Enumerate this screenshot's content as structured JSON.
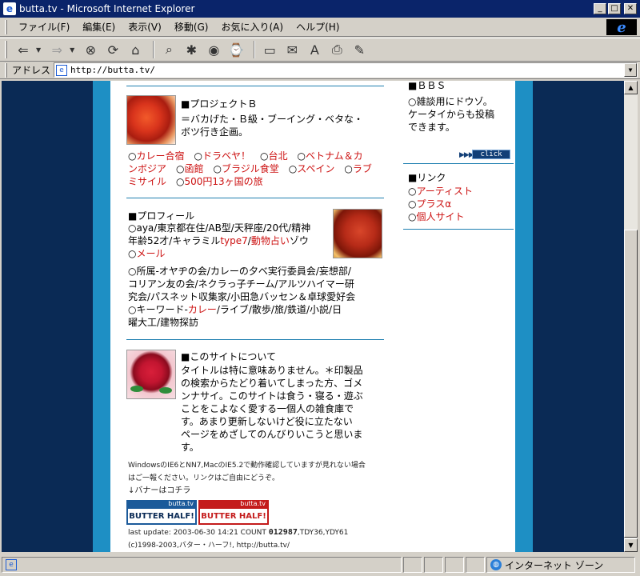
{
  "window": {
    "title": "butta.tv - Microsoft Internet Explorer"
  },
  "menu": [
    "ファイル(F)",
    "編集(E)",
    "表示(V)",
    "移動(G)",
    "お気に入り(A)",
    "ヘルプ(H)"
  ],
  "address": {
    "label": "アドレス",
    "url": "http://butta.tv/"
  },
  "page": {
    "bbs": {
      "title": "■ＢＢＳ",
      "text": [
        "○雑談用にドウゾ。",
        "ケータイからも投稿",
        "できます。"
      ],
      "click_label": "click"
    },
    "links": {
      "title": "■リンク",
      "items": [
        "アーティスト",
        "プラスα",
        "個人サイト"
      ]
    },
    "project": {
      "title": "■プロジェクトＢ",
      "desc": [
        "＝バカげた・Ｂ級・ブーイング・ベタな・",
        "ボツ行き企画。"
      ],
      "links": [
        "カレー合宿",
        "ドラベヤ！",
        "台北",
        "ベトナム＆カ",
        "ンボジア",
        "函館",
        "ブラジル食堂",
        "スペイン",
        "ラブ",
        "ミサイル",
        "500円13ヶ国の旅"
      ]
    },
    "profile": {
      "title": "■プロフィール",
      "line1": "○aya/東京都在住/AB型/天秤座/20代/精神",
      "line2_pre": "年齢52才/キャラミル",
      "line2_link1": "type7",
      "line2_sep": "/",
      "line2_link2": "動物占い",
      "line2_post": "ゾウ",
      "mail_pre": "○",
      "mail_link": "メール",
      "groups": [
        "○所属-オヤヂの会/カレーの夕べ実行委員会/妄想部/",
        "コリアン友の会/ネクラっ子チーム/アルツハイマー研",
        "究会/パスネット収集家/小田急バッセン＆卓球愛好会"
      ],
      "kw_pre": "○キーワード-",
      "kw_link": "カレー",
      "kw_post": "/ライブ/散歩/旅/鉄道/小説/日",
      "kw_line2": "曜大工/建物探訪"
    },
    "about": {
      "title": "■このサイトについて",
      "text": [
        "タイトルは特に意味ありません。＊印製品",
        "の検索からたどり着いてしまった方、ゴメ",
        "ンナサイ。このサイトは食う・寝る・遊ぶ",
        "ことをこよなく愛する一個人の雑食庫で",
        "す。あまり更新しないけど役に立たない",
        "ページをめざしてのんびりいこうと思いま",
        "す。"
      ]
    },
    "notice": [
      "WindowsのIE6とNN7,MacのIE5.2で動作確認していますが見れない場合",
      "はご一報ください。リンクはご自由にどうぞ。"
    ],
    "banner_note": "↓バナーはコチラ",
    "banners": [
      {
        "top": "butta.tv",
        "text": "BUTTER HALF!"
      },
      {
        "top": "butta.tv",
        "text": "BUTTER HALF!"
      }
    ],
    "footer": {
      "update": "last update: 2003-06-30 14:21 COUNT",
      "count": "012987",
      "tdy": ",TDY36,YDY61",
      "copyright": "(c)1998-2003,バター・ハーフ!, http://butta.tv/"
    }
  },
  "status": {
    "zone": "インターネット ゾーン"
  },
  "colors": {
    "accent": "#cc1111",
    "stripe": "#1e8fc4",
    "background": "#0a2a55"
  }
}
